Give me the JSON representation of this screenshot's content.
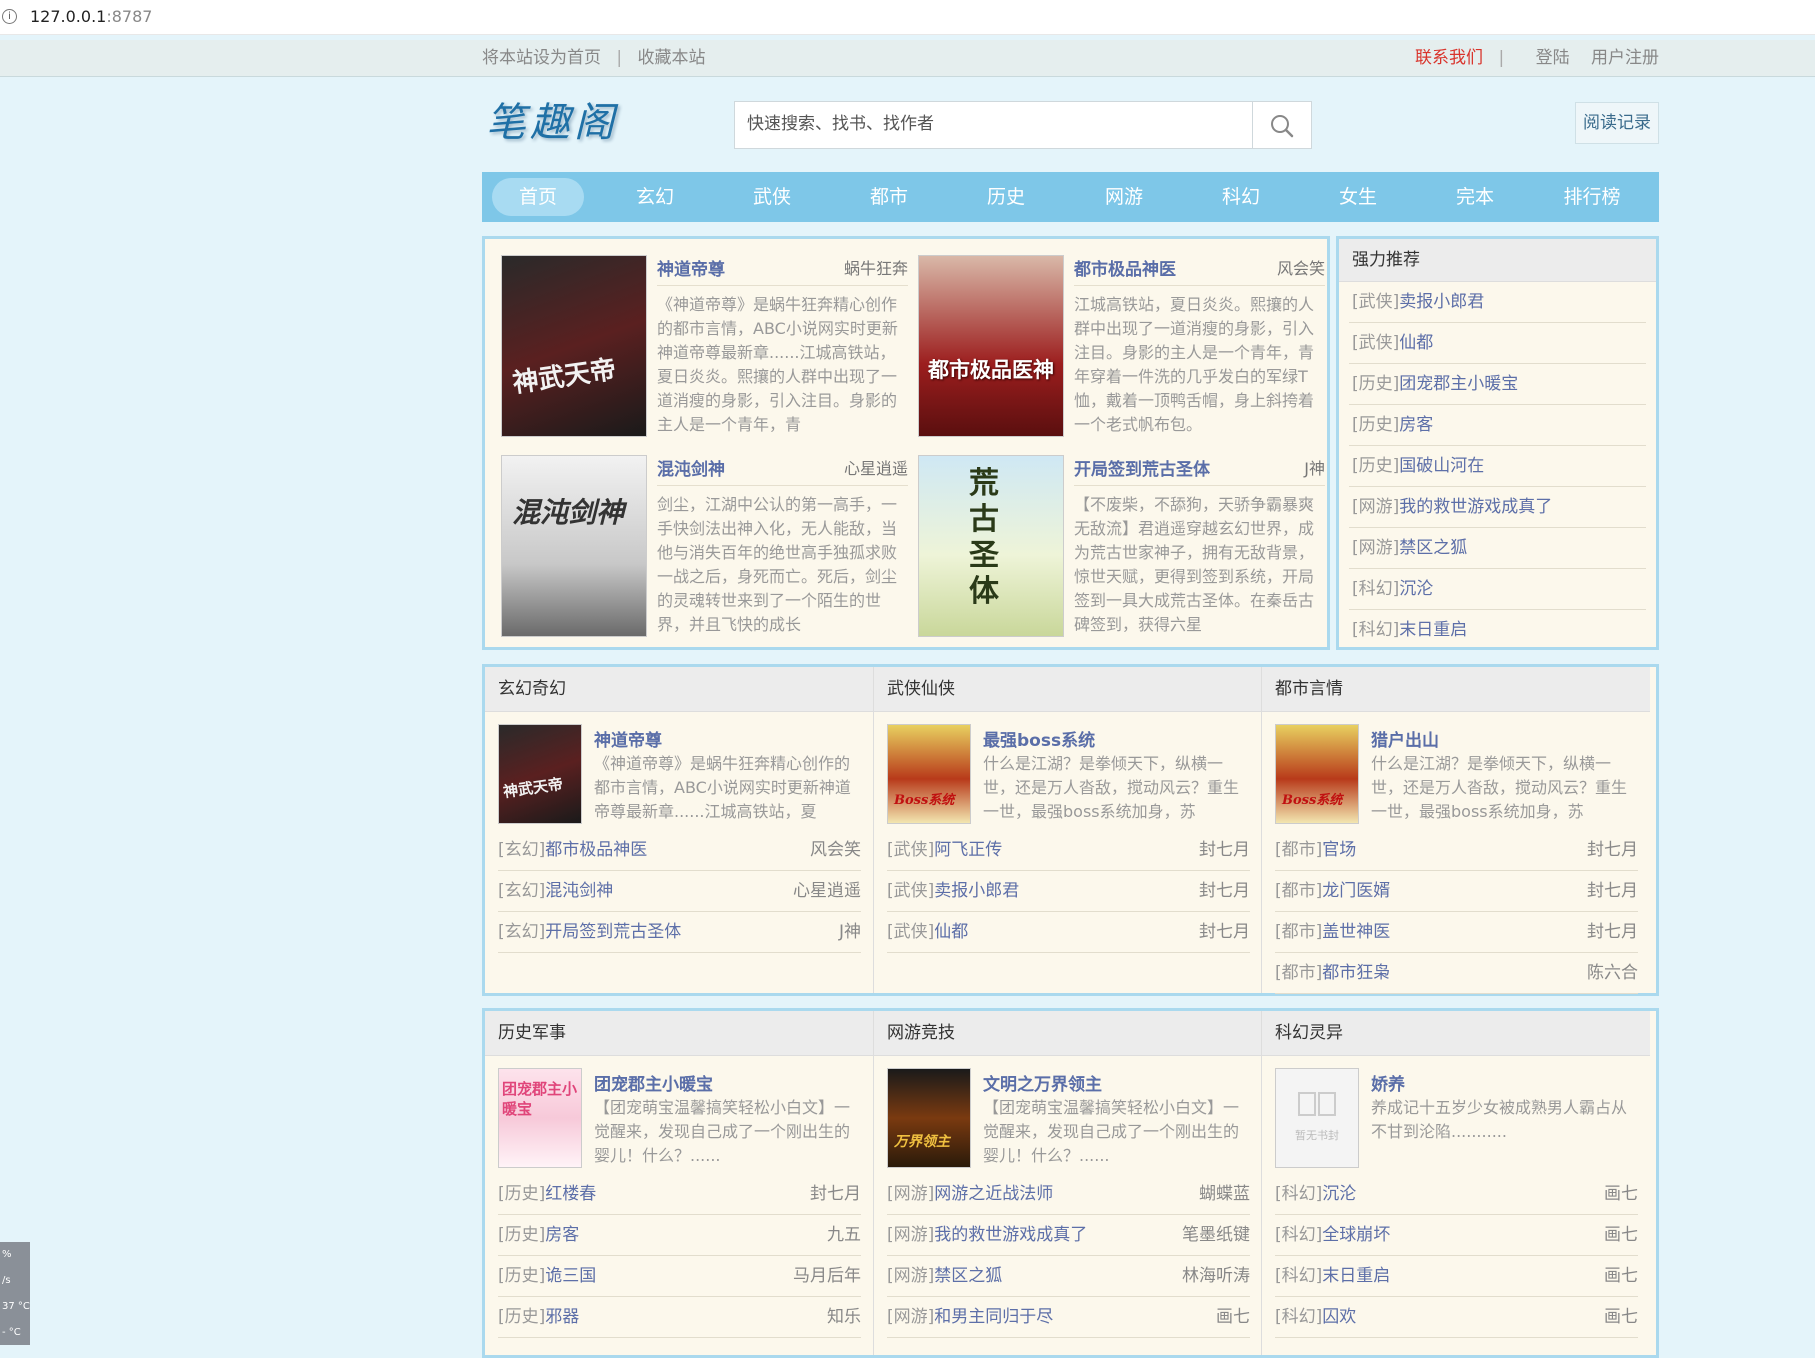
{
  "browser": {
    "url_host": "127.0.0.1",
    "url_port": ":8787"
  },
  "topbar": {
    "set_home": "将本站设为首页",
    "bookmark": "收藏本站",
    "contact": "联系我们",
    "login": "登陆",
    "register": "用户注册"
  },
  "header": {
    "logo": "笔趣阁",
    "search_placeholder": "快速搜索、找书、找作者",
    "history_button": "阅读记录"
  },
  "nav": [
    "首页",
    "玄幻",
    "武侠",
    "都市",
    "历史",
    "网游",
    "科幻",
    "女生",
    "完本",
    "排行榜"
  ],
  "featured": [
    {
      "title": "神道帝尊",
      "author": "蜗牛狂奔",
      "desc": "《神道帝尊》是蜗牛狂奔精心创作的都市言情，ABC小说网实时更新神道帝尊最新章......江城高铁站，夏日炎炎。熙攘的人群中出现了一道消瘦的身影，引入注目。身影的主人是一个青年，青",
      "cover": "神武天帝"
    },
    {
      "title": "都市极品神医",
      "author": "风会笑",
      "desc": "江城高铁站，夏日炎炎。熙攘的人群中出现了一道消瘦的身影，引入注目。身影的主人是一个青年，青年穿着一件洗的几乎发白的军绿T恤，戴着一顶鸭舌帽，身上斜挎着一个老式帆布包。",
      "cover": "都市极品医神"
    },
    {
      "title": "混沌剑神",
      "author": "心星逍遥",
      "desc": "剑尘，江湖中公认的第一高手，一手快剑法出神入化，无人能敌，当他与消失百年的绝世高手独孤求败一战之后，身死而亡。死后，剑尘的灵魂转世来到了一个陌生的世界，并且飞快的成长",
      "cover": "混沌剑神"
    },
    {
      "title": "开局签到荒古圣体",
      "author": "J神",
      "desc": "【不废柴，不舔狗，天骄争霸暴爽无敌流】君逍遥穿越玄幻世界，成为荒古世家神子，拥有无敌背景，惊世天赋，更得到签到系统，开局签到一具大成荒古圣体。在秦岳古碑签到，获得六星",
      "cover": "荒古圣体"
    }
  ],
  "strong_recommend": {
    "title": "强力推荐",
    "items": [
      {
        "cat": "[武侠]",
        "name": "卖报小郎君"
      },
      {
        "cat": "[武侠]",
        "name": "仙都"
      },
      {
        "cat": "[历史]",
        "name": "团宠郡主小暖宝"
      },
      {
        "cat": "[历史]",
        "name": "房客"
      },
      {
        "cat": "[历史]",
        "name": "国破山河在"
      },
      {
        "cat": "[网游]",
        "name": "我的救世游戏成真了"
      },
      {
        "cat": "[网游]",
        "name": "禁区之狐"
      },
      {
        "cat": "[科幻]",
        "name": "沉沦"
      },
      {
        "cat": "[科幻]",
        "name": "末日重启"
      }
    ]
  },
  "sections_row1": [
    {
      "title": "玄幻奇幻",
      "top": {
        "title": "神道帝尊",
        "desc": "《神道帝尊》是蜗牛狂奔精心创作的都市言情，ABC小说网实时更新神道帝尊最新章......江城高铁站，夏",
        "cover": "神武天帝"
      },
      "items": [
        {
          "cat": "[玄幻]",
          "name": "都市极品神医",
          "author": "风会笑"
        },
        {
          "cat": "[玄幻]",
          "name": "混沌剑神",
          "author": "心星逍遥"
        },
        {
          "cat": "[玄幻]",
          "name": "开局签到荒古圣体",
          "author": "J神"
        }
      ]
    },
    {
      "title": "武侠仙侠",
      "top": {
        "title": "最强boss系统",
        "desc": "什么是江湖？是拳倾天下，纵横一世，还是万人沓敌，搅动风云？重生一世，最强boss系统加身，苏",
        "cover": "Boss系统"
      },
      "items": [
        {
          "cat": "[武侠]",
          "name": "阿飞正传",
          "author": "封七月"
        },
        {
          "cat": "[武侠]",
          "name": "卖报小郎君",
          "author": "封七月"
        },
        {
          "cat": "[武侠]",
          "name": "仙都",
          "author": "封七月"
        }
      ]
    },
    {
      "title": "都市言情",
      "top": {
        "title": "猎户出山",
        "desc": "什么是江湖？是拳倾天下，纵横一世，还是万人沓敌，搅动风云？重生一世，最强boss系统加身，苏",
        "cover": "Boss系统"
      },
      "items": [
        {
          "cat": "[都市]",
          "name": "官场",
          "author": "封七月"
        },
        {
          "cat": "[都市]",
          "name": "龙门医婿",
          "author": "封七月"
        },
        {
          "cat": "[都市]",
          "name": "盖世神医",
          "author": "封七月"
        },
        {
          "cat": "[都市]",
          "name": "都市狂枭",
          "author": "陈六合"
        }
      ]
    }
  ],
  "sections_row2": [
    {
      "title": "历史军事",
      "top": {
        "title": "团宠郡主小暖宝",
        "desc": "【团宠萌宝温馨搞笑轻松小白文】一觉醒来，发现自己成了一个刚出生的婴儿！什么？......",
        "cover": "团宠郡主小暖宝"
      },
      "items": [
        {
          "cat": "[历史]",
          "name": "红楼春",
          "author": "封七月"
        },
        {
          "cat": "[历史]",
          "name": "房客",
          "author": "九五"
        },
        {
          "cat": "[历史]",
          "name": "诡三国",
          "author": "马月后年"
        },
        {
          "cat": "[历史]",
          "name": "邪器",
          "author": "知乐"
        }
      ]
    },
    {
      "title": "网游竞技",
      "top": {
        "title": "文明之万界领主",
        "desc": "【团宠萌宝温馨搞笑轻松小白文】一觉醒来，发现自己成了一个刚出生的婴儿！什么？......",
        "cover": "万界领主"
      },
      "items": [
        {
          "cat": "[网游]",
          "name": "网游之近战法师",
          "author": "蝴蝶蓝"
        },
        {
          "cat": "[网游]",
          "name": "我的救世游戏成真了",
          "author": "笔墨纸键"
        },
        {
          "cat": "[网游]",
          "name": "禁区之狐",
          "author": "林海听涛"
        },
        {
          "cat": "[网游]",
          "name": "和男主同归于尽",
          "author": "画七"
        }
      ]
    },
    {
      "title": "科幻灵异",
      "top": {
        "title": "娇养",
        "desc": "养成记十五岁少女被成熟男人霸占从不甘到沦陷...........",
        "cover": "暂无书封"
      },
      "items": [
        {
          "cat": "[科幻]",
          "name": "沉沦",
          "author": "画七"
        },
        {
          "cat": "[科幻]",
          "name": "全球崩坏",
          "author": "画七"
        },
        {
          "cat": "[科幻]",
          "name": "末日重启",
          "author": "画七"
        },
        {
          "cat": "[科幻]",
          "name": "囚欢",
          "author": "画七"
        }
      ]
    }
  ],
  "side_widget": [
    "%",
    "/s",
    "37 °C",
    "- °C"
  ]
}
